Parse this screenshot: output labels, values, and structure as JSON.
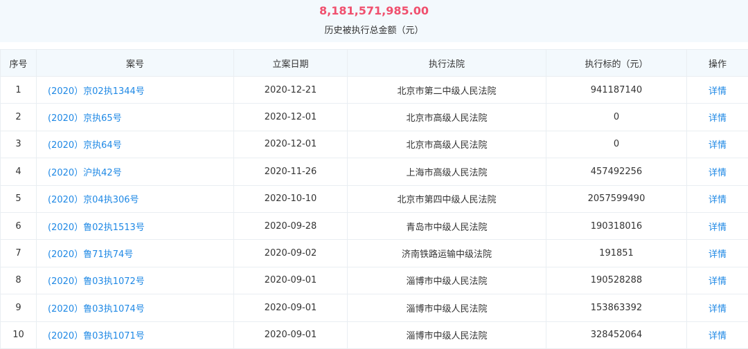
{
  "summary": {
    "total_amount": "8,181,571,985.00",
    "label": "历史被执行总金额（元）"
  },
  "table": {
    "headers": [
      "序号",
      "案号",
      "立案日期",
      "执行法院",
      "执行标的（元）",
      "操作"
    ],
    "rows": [
      {
        "index": "1",
        "case_no": "(2020）京02执1344号",
        "filing_date": "2020-12-21",
        "court": "北京市第二中级人民法院",
        "amount": "941187140",
        "action": "详情"
      },
      {
        "index": "2",
        "case_no": "(2020）京执65号",
        "filing_date": "2020-12-01",
        "court": "北京市高级人民法院",
        "amount": "0",
        "action": "详情"
      },
      {
        "index": "3",
        "case_no": "(2020）京执64号",
        "filing_date": "2020-12-01",
        "court": "北京市高级人民法院",
        "amount": "0",
        "action": "详情"
      },
      {
        "index": "4",
        "case_no": "(2020）沪执42号",
        "filing_date": "2020-11-26",
        "court": "上海市高级人民法院",
        "amount": "457492256",
        "action": "详情"
      },
      {
        "index": "5",
        "case_no": "(2020）京04执306号",
        "filing_date": "2020-10-10",
        "court": "北京市第四中级人民法院",
        "amount": "2057599490",
        "action": "详情"
      },
      {
        "index": "6",
        "case_no": "(2020）鲁02执1513号",
        "filing_date": "2020-09-28",
        "court": "青岛市中级人民法院",
        "amount": "190318016",
        "action": "详情"
      },
      {
        "index": "7",
        "case_no": "(2020）鲁71执74号",
        "filing_date": "2020-09-02",
        "court": "济南铁路运输中级法院",
        "amount": "191851",
        "action": "详情"
      },
      {
        "index": "8",
        "case_no": "(2020）鲁03执1072号",
        "filing_date": "2020-09-01",
        "court": "淄博市中级人民法院",
        "amount": "190528288",
        "action": "详情"
      },
      {
        "index": "9",
        "case_no": "(2020）鲁03执1074号",
        "filing_date": "2020-09-01",
        "court": "淄博市中级人民法院",
        "amount": "153863392",
        "action": "详情"
      },
      {
        "index": "10",
        "case_no": "(2020）鲁03执1071号",
        "filing_date": "2020-09-01",
        "court": "淄博市中级人民法院",
        "amount": "328452064",
        "action": "详情"
      }
    ]
  },
  "colors": {
    "amount": "#f0506e",
    "link": "#1e88e5",
    "header_bg": "#f3f9fd",
    "border": "#e9eef2"
  }
}
